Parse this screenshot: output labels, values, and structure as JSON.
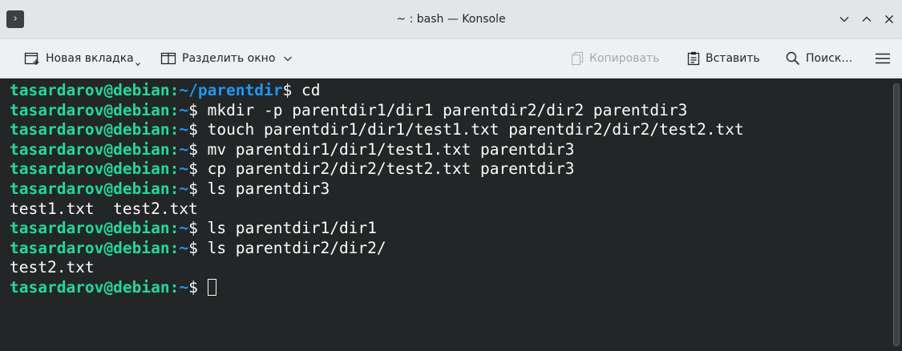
{
  "window": {
    "title": "~ : bash — Konsole",
    "app_icon_glyph": "›"
  },
  "toolbar": {
    "new_tab_label": "Новая вкладка",
    "split_view_label": "Разделить окно",
    "copy_label": "Копировать",
    "paste_label": "Вставить",
    "find_label": "Поиск…"
  },
  "colors": {
    "prompt_user": "#1cdc9a",
    "prompt_path": "#1d99f3",
    "terminal_bg": "#232627",
    "terminal_fg": "#fcfcfc"
  },
  "terminal": {
    "prompt_user_host": "tasardarov@debian",
    "lines": [
      {
        "type": "prompt",
        "path": "~/parentdir",
        "command": " cd"
      },
      {
        "type": "prompt",
        "path": "~",
        "command": " mkdir -p parentdir1/dir1 parentdir2/dir2 parentdir3"
      },
      {
        "type": "prompt",
        "path": "~",
        "command": " touch parentdir1/dir1/test1.txt parentdir2/dir2/test2.txt"
      },
      {
        "type": "prompt",
        "path": "~",
        "command": " mv parentdir1/dir1/test1.txt parentdir3"
      },
      {
        "type": "prompt",
        "path": "~",
        "command": " cp parentdir2/dir2/test2.txt parentdir3"
      },
      {
        "type": "prompt",
        "path": "~",
        "command": " ls parentdir3"
      },
      {
        "type": "output",
        "text": "test1.txt  test2.txt"
      },
      {
        "type": "prompt",
        "path": "~",
        "command": " ls parentdir1/dir1"
      },
      {
        "type": "prompt",
        "path": "~",
        "command": " ls parentdir2/dir2/"
      },
      {
        "type": "output",
        "text": "test2.txt"
      },
      {
        "type": "prompt",
        "path": "~",
        "command": " ",
        "cursor": true
      }
    ]
  }
}
